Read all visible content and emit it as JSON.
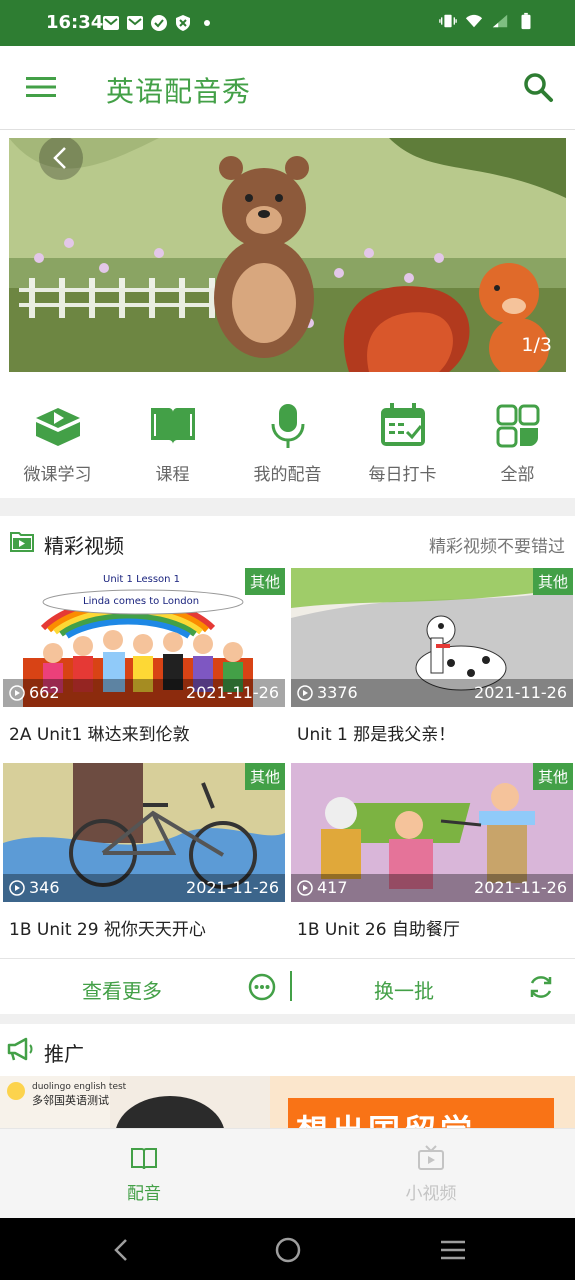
{
  "status_bar": {
    "time": "16:34",
    "left_icons": [
      "mail-icon",
      "mail-icon",
      "check-circle-icon",
      "shield-icon",
      "dot-icon"
    ],
    "right_icons": [
      "vibrate-icon",
      "wifi-icon",
      "signal-icon",
      "battery-icon"
    ]
  },
  "app_bar": {
    "title": "英语配音秀",
    "menu_icon": "menu-icon",
    "search_icon": "search-icon"
  },
  "banner": {
    "counter": "1/3"
  },
  "quick_nav": [
    {
      "label": "微课学习",
      "icon": "play-book-icon"
    },
    {
      "label": "课程",
      "icon": "open-book-icon"
    },
    {
      "label": "我的配音",
      "icon": "microphone-icon"
    },
    {
      "label": "每日打卡",
      "icon": "calendar-check-icon"
    },
    {
      "label": "全部",
      "icon": "grid-icon"
    }
  ],
  "featured": {
    "title": "精彩视频",
    "subtitle": "精彩视频不要错过",
    "videos": [
      {
        "tag": "其他",
        "plays": "662",
        "date": "2021-11-26",
        "title": "2A Unit1 琳达来到伦敦",
        "thumb_text_1": "Unit 1 Lesson 1",
        "thumb_text_2": "Linda comes to London"
      },
      {
        "tag": "其他",
        "plays": "3376",
        "date": "2021-11-26",
        "title": "Unit 1 那是我父亲！"
      },
      {
        "tag": "其他",
        "plays": "346",
        "date": "2021-11-26",
        "title": "1B Unit 29 祝你天天开心"
      },
      {
        "tag": "其他",
        "plays": "417",
        "date": "2021-11-26",
        "title": "1B Unit 26 自助餐厅"
      }
    ],
    "more_label": "查看更多",
    "swap_label": "换一批"
  },
  "promo": {
    "title": "推广",
    "logo_text": "duolingo english test",
    "logo_sub": "多邻国英语测试",
    "ad_text": "想出国留学"
  },
  "bottom_nav": [
    {
      "label": "配音",
      "icon": "book-icon",
      "active": true
    },
    {
      "label": "小视频",
      "icon": "tv-play-icon",
      "active": false
    }
  ],
  "colors": {
    "brand": "#43a047",
    "status_bar": "#2e7d32",
    "inactive": "#c4c4c4"
  }
}
